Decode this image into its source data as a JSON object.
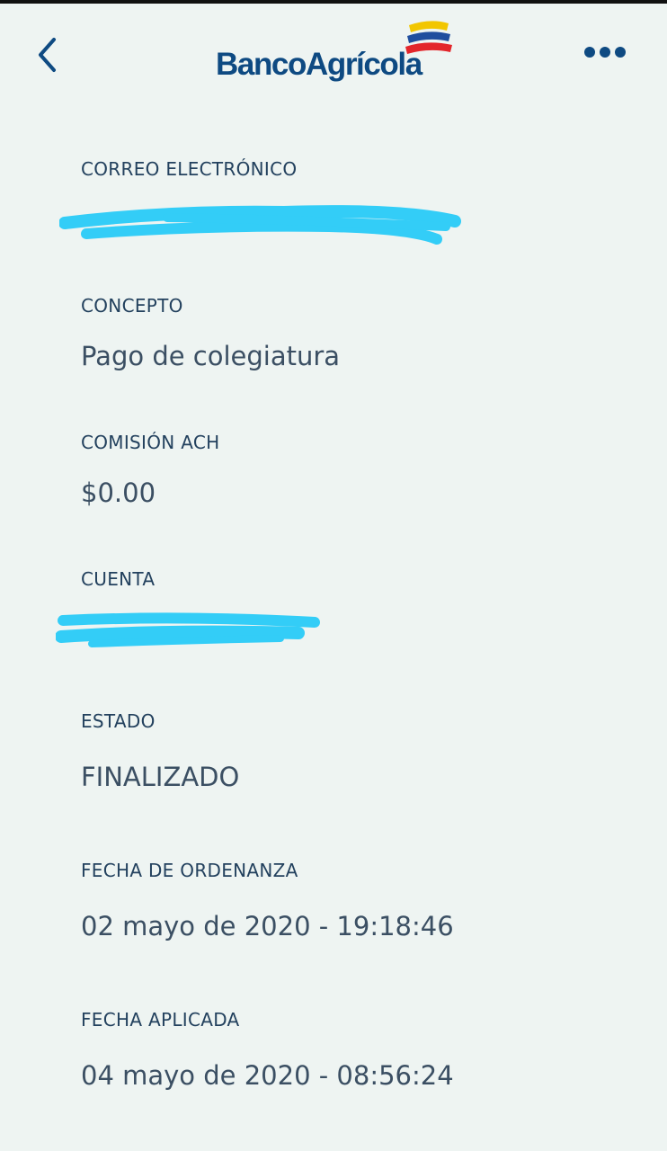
{
  "header": {
    "back_icon": "chevron-left-icon",
    "brand_name": "BancoAgrícola",
    "more_icon": "more-horizontal-icon",
    "brand_colors": [
      "#f2c600",
      "#1f4e9e",
      "#e3262b"
    ]
  },
  "details": {
    "email": {
      "label": "CORREO ELECTRÓNICO",
      "value": ""
    },
    "concept": {
      "label": "CONCEPTO",
      "value": "Pago de colegiatura"
    },
    "fee": {
      "label": "COMISIÓN ACH",
      "value": "$0.00"
    },
    "account": {
      "label": "CUENTA",
      "value": ""
    },
    "status": {
      "label": "ESTADO",
      "value": "FINALIZADO"
    },
    "order_date": {
      "label": "FECHA DE ORDENANZA",
      "value": "02 mayo de 2020 - 19:18:46"
    },
    "applied_date": {
      "label": "FECHA APLICADA",
      "value": "04 mayo de 2020 - 08:56:24"
    }
  },
  "colors": {
    "background": "#eef4f2",
    "label": "#23415e",
    "value": "#3b4f63",
    "brand_blue": "#0e4a82",
    "redaction": "#33cdf7"
  }
}
